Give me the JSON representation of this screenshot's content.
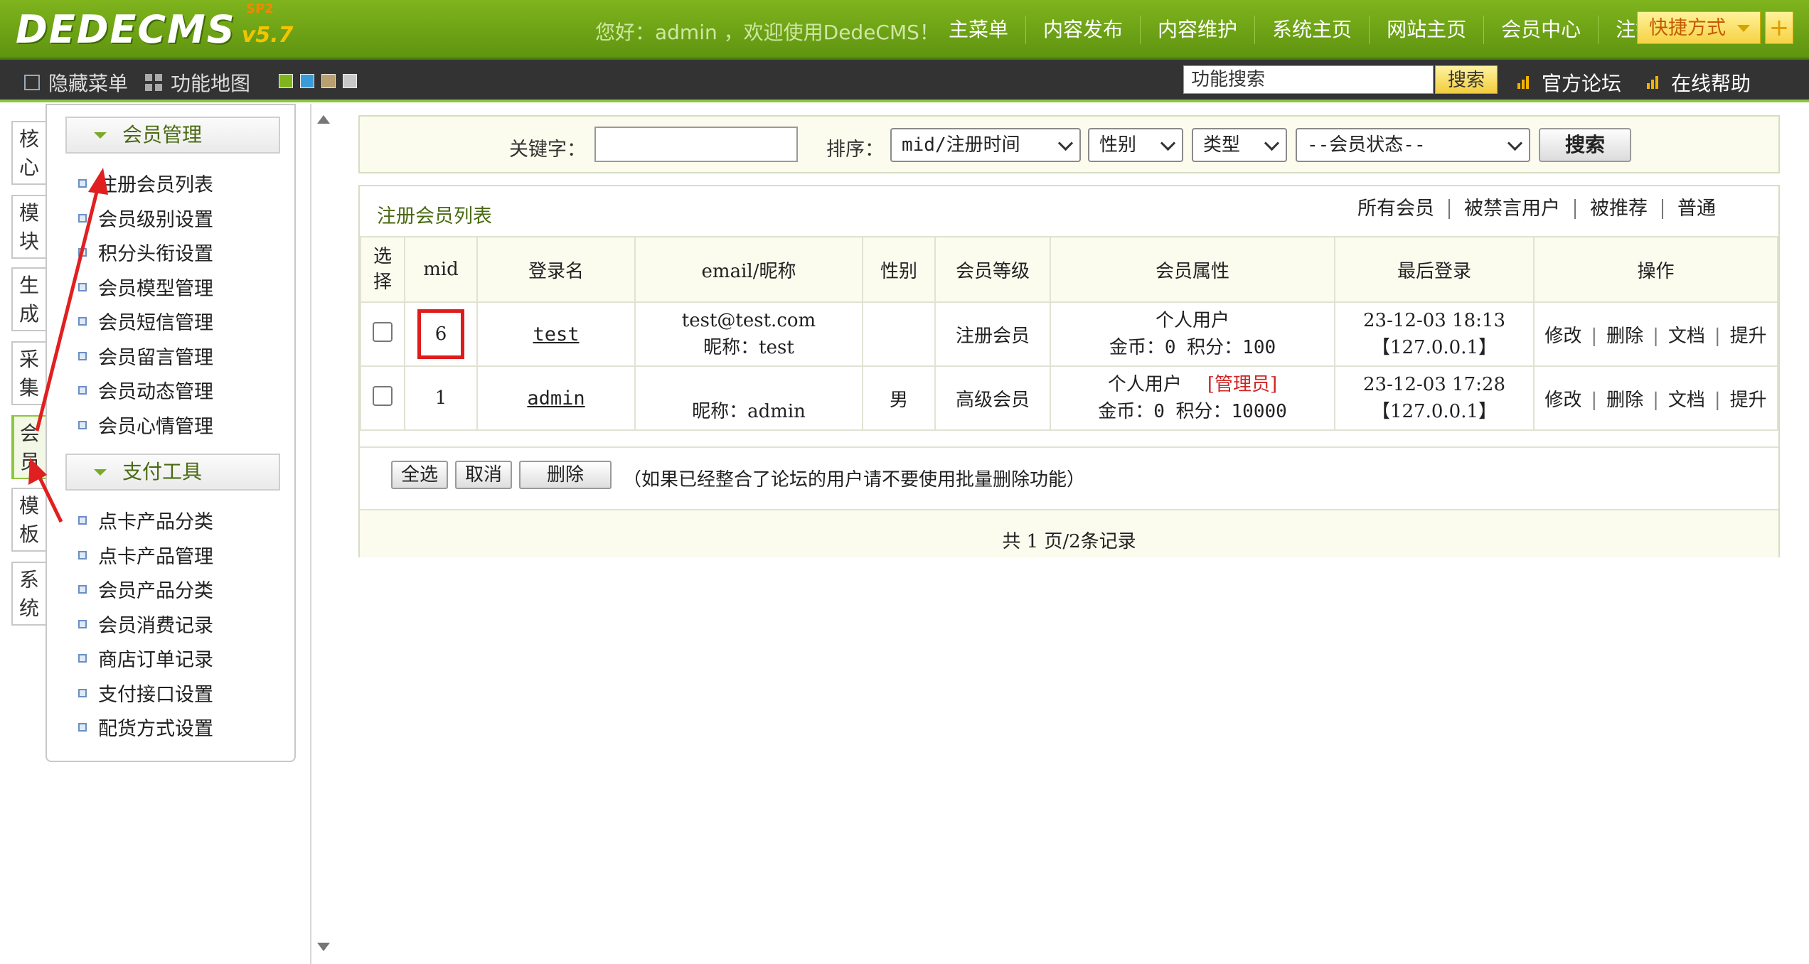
{
  "header": {
    "logo": "DEDECMS",
    "version": "v5.7",
    "sp": "SP2",
    "welcome": "您好：admin ，欢迎使用DedeCMS！",
    "nav": [
      "主菜单",
      "内容发布",
      "内容维护",
      "系统主页",
      "网站主页",
      "会员中心",
      "注销"
    ],
    "quick_label": "快捷方式",
    "quick_plus": "+"
  },
  "toolbar": {
    "hide_menu": "隐藏菜单",
    "func_map": "功能地图",
    "skin_colors": [
      "#7fb41d",
      "#3a9bd9",
      "#b8a070",
      "#c8c8c8"
    ],
    "search_value": "功能搜索",
    "search_button": "搜索",
    "forum": "官方论坛",
    "help": "在线帮助"
  },
  "side_tabs": [
    {
      "label": "核\n心",
      "active": false
    },
    {
      "label": "模\n块",
      "active": false
    },
    {
      "label": "生\n成",
      "active": false
    },
    {
      "label": "采\n集",
      "active": false
    },
    {
      "label": "会\n员",
      "active": true
    },
    {
      "label": "模\n板",
      "active": false
    },
    {
      "label": "系\n统",
      "active": false
    }
  ],
  "menu": {
    "group1_title": "会员管理",
    "group1_items": [
      "注册会员列表",
      "会员级别设置",
      "积分头衔设置",
      "会员模型管理",
      "会员短信管理",
      "会员留言管理",
      "会员动态管理",
      "会员心情管理"
    ],
    "group2_title": "支付工具",
    "group2_items": [
      "点卡产品分类",
      "点卡产品管理",
      "会员产品分类",
      "会员消费记录",
      "商店订单记录",
      "支付接口设置",
      "配货方式设置"
    ]
  },
  "search": {
    "keyword_label": "关键字：",
    "keyword_value": "",
    "sort_label": "排序：",
    "sort_value": "mid/注册时间",
    "gender_value": "性别",
    "type_value": "类型",
    "status_value": "--会员状态--",
    "button": "搜索"
  },
  "list": {
    "title": "注册会员列表",
    "filters": [
      "所有会员",
      "被禁言用户",
      "被推荐",
      "普通"
    ],
    "columns": [
      "选\n择",
      "mid",
      "登录名",
      "email/昵称",
      "性别",
      "会员等级",
      "会员属性",
      "最后登录",
      "操作"
    ],
    "rows": [
      {
        "mid": "6",
        "login": "test",
        "email": "test@test.com",
        "nick": "昵称：test",
        "gender": "",
        "level": "注册会员",
        "attr": "个人用户",
        "admin_tag": "",
        "coins": "金币：0 积分：100",
        "last_time": "23-12-03 18:13",
        "last_ip": "【127.0.0.1】",
        "highlight": true
      },
      {
        "mid": "1",
        "login": "admin",
        "email": "",
        "nick": "昵称：admin",
        "gender": "男",
        "level": "高级会员",
        "attr": "个人用户",
        "admin_tag": "[管理员]",
        "coins": "金币：0 积分：10000",
        "last_time": "23-12-03 17:28",
        "last_ip": "【127.0.0.1】",
        "highlight": false
      }
    ],
    "ops": [
      "修改",
      "删除",
      "文档",
      "提升"
    ],
    "select_all": "全选",
    "cancel": "取消",
    "delete": "删除",
    "note": "（如果已经整合了论坛的用户请不要使用批量删除功能）",
    "pager": "共 1 页/2条记录"
  }
}
